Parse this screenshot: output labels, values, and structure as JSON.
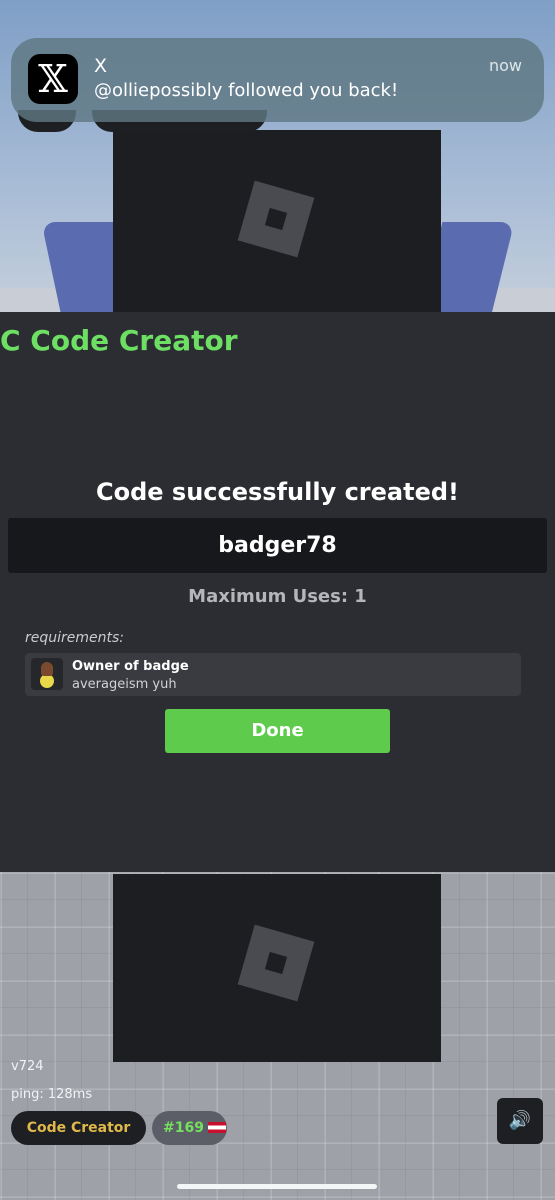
{
  "notification": {
    "app_glyph": "𝕏",
    "app": "X",
    "message": "@olliepossibly followed you back!",
    "time": "now"
  },
  "modal": {
    "title": "C Code Creator",
    "success_message": "Code successfully created!",
    "code": "badger78",
    "max_uses": "Maximum Uses: 1",
    "requirements_label": "requirements:",
    "requirement": {
      "title": "Owner of badge",
      "badge_name": "averageism yuh"
    },
    "done_button": "Done"
  },
  "hud": {
    "version": "v724",
    "ping": "ping: 128ms",
    "code_creator_button": "Code Creator",
    "rank": "#169",
    "sound_icon": "🔊"
  },
  "colors": {
    "accent_green": "#6de063",
    "done_green": "#5fcb4c",
    "gold": "#e0b94b",
    "modal_bg": "#2c2d33"
  }
}
